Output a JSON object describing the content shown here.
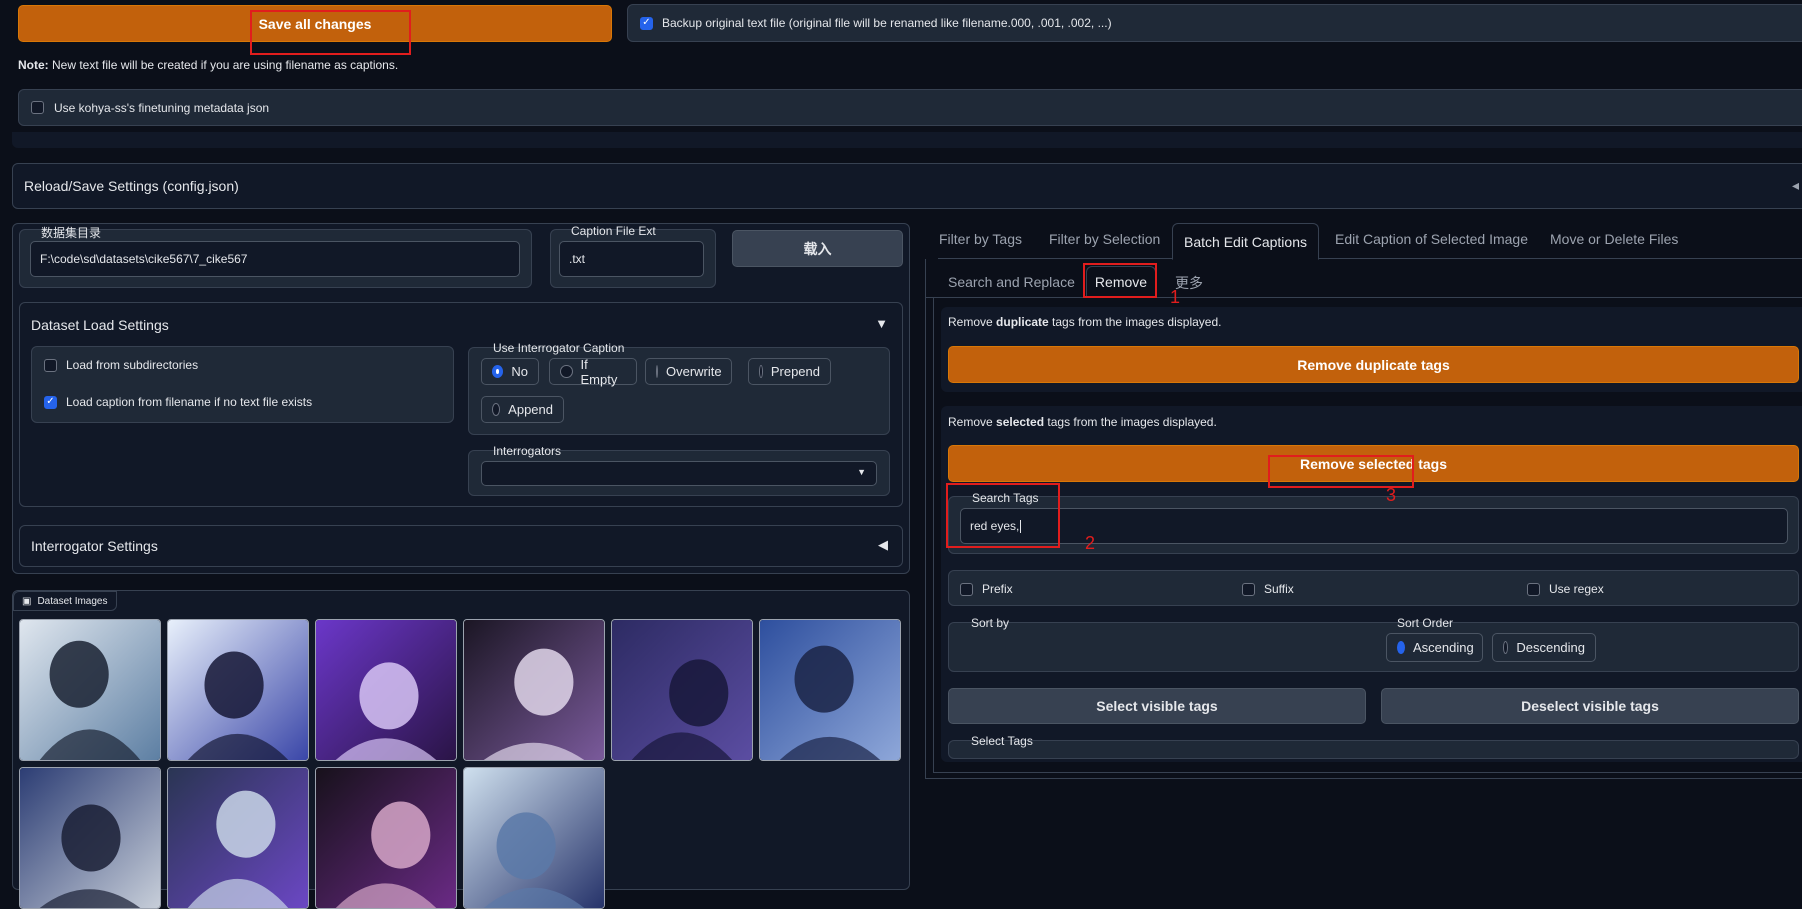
{
  "top": {
    "save_button": "Save all changes",
    "backup_label": "Backup original text file (original file will be renamed like filename.000, .001, .002, ...)",
    "backup_checked": true,
    "note_bold": "Note:",
    "note_text": " New text file will be created if you are using filename as captions.",
    "kohya_label": "Use kohya-ss's finetuning metadata json",
    "kohya_checked": false
  },
  "reload_section": {
    "title": "Reload/Save Settings (config.json)"
  },
  "dataset": {
    "dir_label": "数据集目录",
    "dir_value": "F:\\code\\sd\\datasets\\cike567\\7_cike567",
    "ext_label": "Caption File Ext",
    "ext_value": ".txt",
    "load_button": "载入"
  },
  "load_settings": {
    "title": "Dataset Load Settings",
    "subdirs_label": "Load from subdirectories",
    "subdirs_checked": false,
    "caption_label": "Load caption from filename if no text file exists",
    "caption_checked": true,
    "interrogator_caption_label": "Use Interrogator Caption",
    "options": [
      "No",
      "If Empty",
      "Overwrite",
      "Prepend",
      "Append"
    ],
    "selected_option": "No",
    "interrogators_label": "Interrogators",
    "interrogators_value": ""
  },
  "interrogator_settings": {
    "title": "Interrogator Settings"
  },
  "gallery": {
    "label": "Dataset Images",
    "count": 10
  },
  "main_tabs": {
    "items": [
      "Filter by Tags",
      "Filter by Selection",
      "Batch Edit Captions",
      "Edit Caption of Selected Image",
      "Move or Delete Files"
    ],
    "active": "Batch Edit Captions"
  },
  "sub_tabs": {
    "items": [
      "Search and Replace",
      "Remove",
      "更多"
    ],
    "active": "Remove"
  },
  "remove": {
    "dup_pre": "Remove ",
    "dup_bold": "duplicate",
    "dup_post": " tags from the images displayed.",
    "dup_button": "Remove duplicate tags",
    "sel_pre": "Remove ",
    "sel_bold": "selected",
    "sel_post": " tags from the images displayed.",
    "sel_button": "Remove selected tags",
    "search_label": "Search Tags",
    "search_value": "red eyes,",
    "prefix_label": "Prefix",
    "suffix_label": "Suffix",
    "regex_label": "Use regex",
    "sort_by_label": "Sort by",
    "sort_order_label": "Sort Order",
    "sort_orders": [
      "Ascending",
      "Descending"
    ],
    "sort_selected": "Ascending",
    "select_visible": "Select visible tags",
    "deselect_visible": "Deselect visible tags",
    "select_tags_label": "Select Tags"
  },
  "annotations": {
    "n1": "1",
    "n2": "2",
    "n3": "3",
    "color": "#e11d1d"
  },
  "colors": {
    "accent_orange": "#c2610c",
    "accent_blue": "#2563eb",
    "background": "#0b0f19"
  }
}
